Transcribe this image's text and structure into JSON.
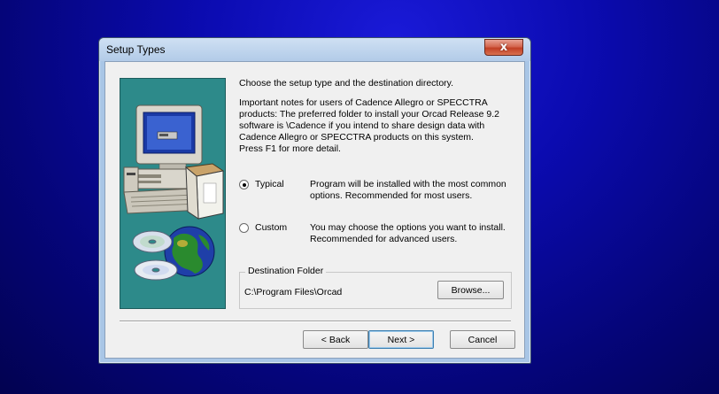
{
  "window": {
    "title": "Setup Types",
    "close_glyph": "x"
  },
  "content": {
    "intro": "Choose the setup type and the destination directory.",
    "notes": "Important notes for users of Cadence Allegro or SPECCTRA\nproducts:  The preferred folder to install your Orcad Release 9.2\nsoftware is \\Cadence if you intend to share design data with\nCadence Allegro or SPECCTRA products on this system.\nPress F1 for more detail."
  },
  "options": [
    {
      "label": "Typical",
      "checked": true,
      "description": "Program will be installed with the most common options. Recommended for most users."
    },
    {
      "label": "Custom",
      "checked": false,
      "description": "You may choose the options you want to install. Recommended for advanced users."
    }
  ],
  "destination": {
    "legend": "Destination Folder",
    "path": "C:\\Program Files\\Orcad",
    "browse_label": "Browse..."
  },
  "buttons": {
    "back": "< Back",
    "next": "Next >",
    "cancel": "Cancel"
  },
  "colors": {
    "desktop": "#0b0bb0",
    "art_bg": "#2d8a8a",
    "close": "#c13f25"
  },
  "icons": [
    "computer-illustration",
    "cd-disc-icon",
    "globe-icon",
    "box-icon"
  ]
}
